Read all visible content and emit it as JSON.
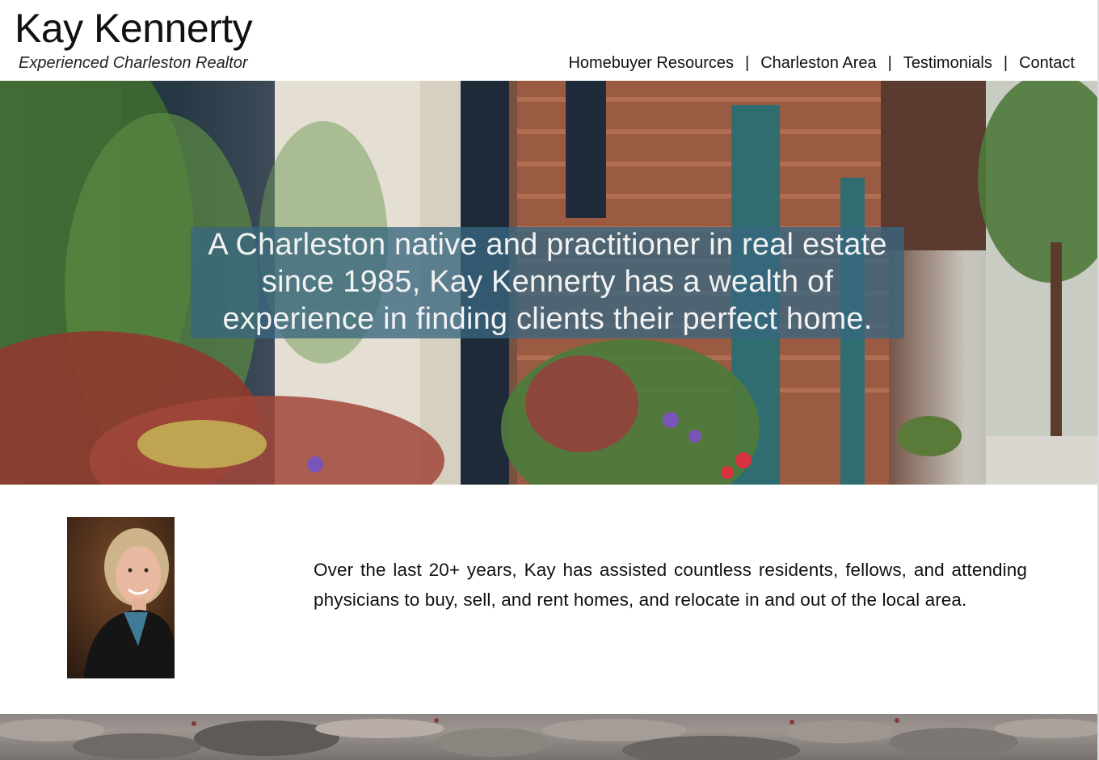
{
  "header": {
    "title": "Kay Kennerty",
    "tagline": "Experienced Charleston Realtor"
  },
  "nav": {
    "items": [
      {
        "label": "Homebuyer Resources"
      },
      {
        "label": "Charleston Area"
      },
      {
        "label": "Testimonials"
      },
      {
        "label": "Contact"
      }
    ],
    "separator": "|"
  },
  "hero": {
    "line1": "A Charleston native and practitioner in real estate",
    "line2": "since 1985, Kay Kennerty has a wealth of",
    "line3": "experience in finding clients their perfect home."
  },
  "about": {
    "text": "Over the last 20+ years, Kay has assisted countless residents, fellows, and attending physicians to buy, sell, and rent homes, and relocate in and out of the local area."
  },
  "colors": {
    "overlay": "#386680",
    "text": "#111111"
  }
}
